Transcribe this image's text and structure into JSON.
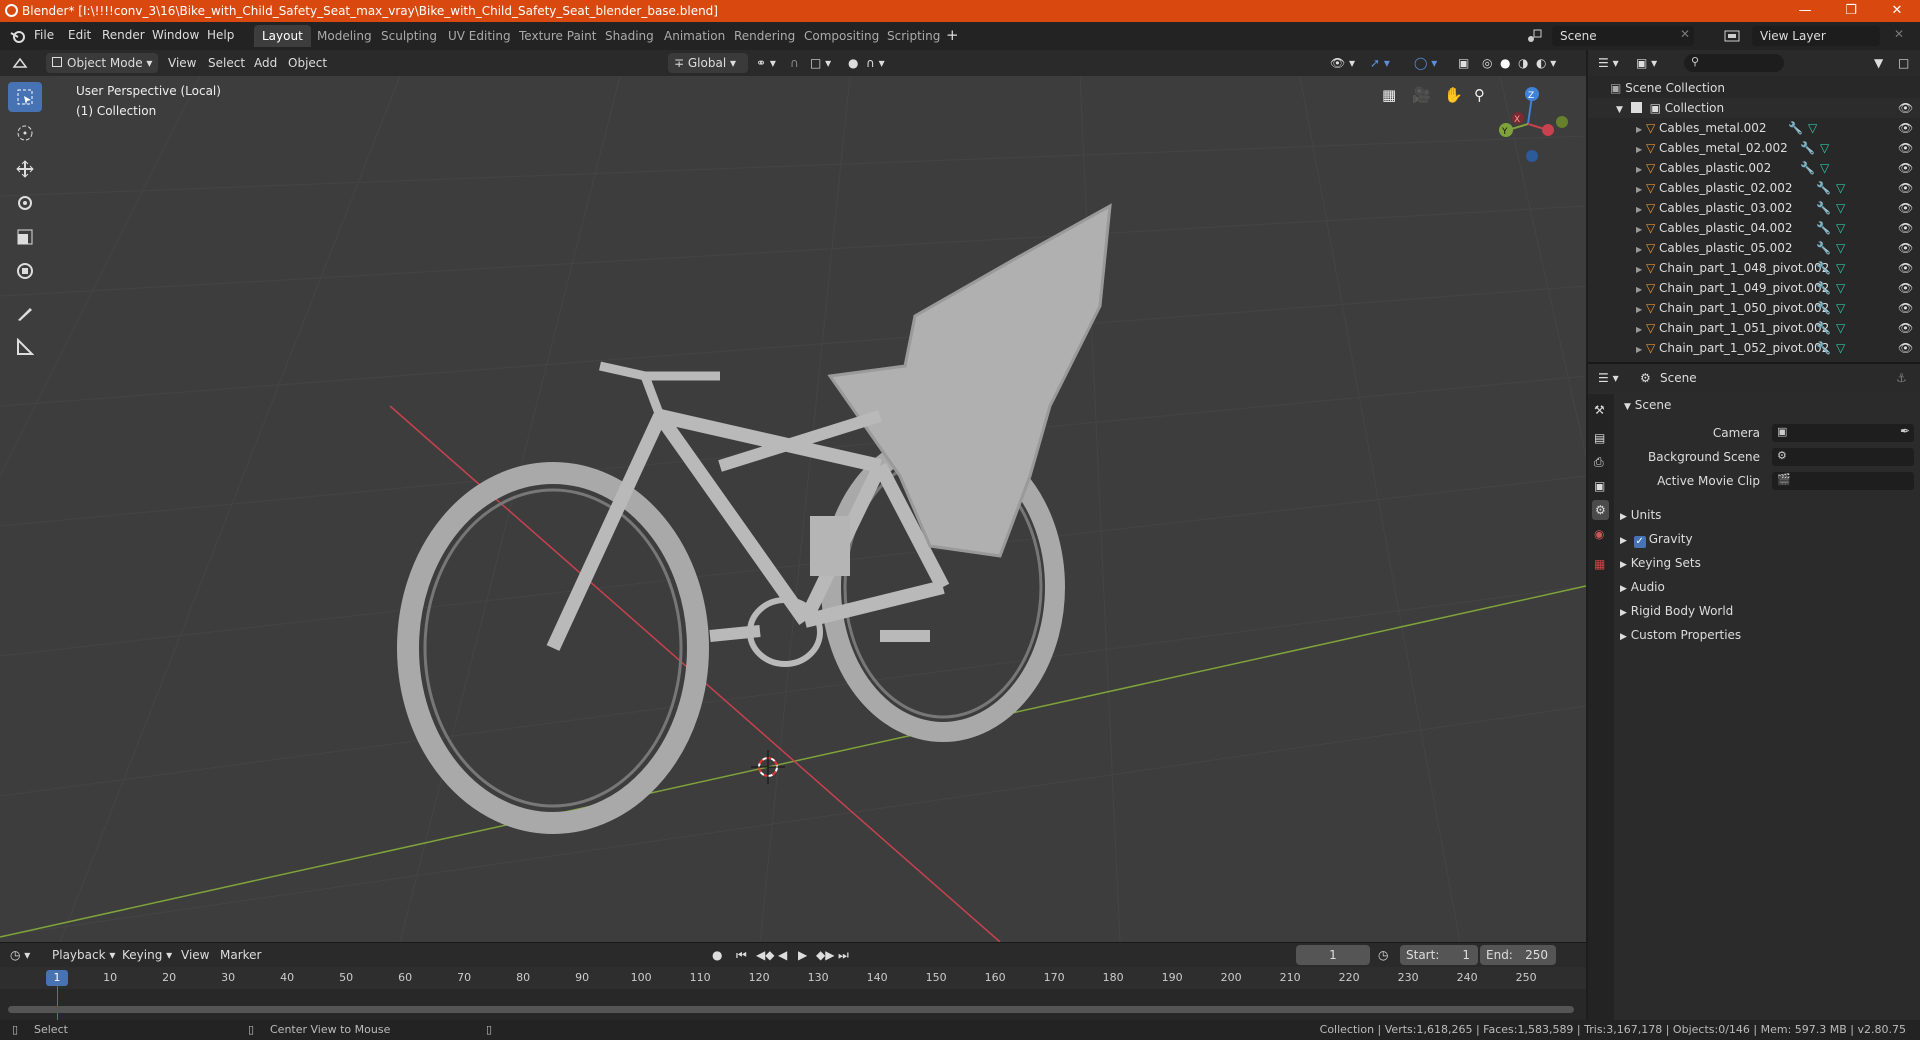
{
  "title": "Blender* [I:\\!!!!conv_3\\16\\Bike_with_Child_Safety_Seat_max_vray\\Bike_with_Child_Safety_Seat_blender_base.blend]",
  "menus": [
    "File",
    "Edit",
    "Render",
    "Window",
    "Help"
  ],
  "workspaces": [
    "Layout",
    "Modeling",
    "Sculpting",
    "UV Editing",
    "Texture Paint",
    "Shading",
    "Animation",
    "Rendering",
    "Compositing",
    "Scripting"
  ],
  "active_workspace": "Layout",
  "scene_field": "Scene",
  "view_layer_field": "View Layer",
  "viewport_header": {
    "mode": "Object Mode",
    "menus": [
      "View",
      "Select",
      "Add",
      "Object"
    ],
    "transform_orientation": "Global"
  },
  "viewport": {
    "perspective_label": "User Perspective (Local)",
    "collection_label": "(1) Collection",
    "gizmo_axes": [
      "X",
      "Y",
      "Z"
    ]
  },
  "outliner": {
    "root": "Scene Collection",
    "collection": "Collection",
    "items": [
      "Cables_metal.002",
      "Cables_metal_02.002",
      "Cables_plastic.002",
      "Cables_plastic_02.002",
      "Cables_plastic_03.002",
      "Cables_plastic_04.002",
      "Cables_plastic_05.002",
      "Chain_part_1_048_pivot.002",
      "Chain_part_1_049_pivot.002",
      "Chain_part_1_050_pivot.002",
      "Chain_part_1_051_pivot.002",
      "Chain_part_1_052_pivot.002"
    ]
  },
  "properties": {
    "header": "Scene",
    "panel_title": "Scene",
    "fields": [
      "Camera",
      "Background Scene",
      "Active Movie Clip"
    ],
    "sections": [
      "Units",
      "Gravity",
      "Keying Sets",
      "Audio",
      "Rigid Body World",
      "Custom Properties"
    ],
    "gravity_checked": true
  },
  "timeline": {
    "menus": [
      "Playback",
      "Keying",
      "View",
      "Marker"
    ],
    "current_frame": "1",
    "start_label": "Start:",
    "start": "1",
    "end_label": "End:",
    "end": "250",
    "ruler": [
      "1",
      "10",
      "20",
      "30",
      "40",
      "50",
      "60",
      "70",
      "80",
      "90",
      "100",
      "110",
      "120",
      "130",
      "140",
      "150",
      "160",
      "170",
      "180",
      "190",
      "200",
      "210",
      "220",
      "230",
      "240",
      "250"
    ]
  },
  "status": {
    "left": "Select",
    "middle": "Center View to Mouse",
    "right": "Collection | Verts:1,618,265 | Faces:1,583,589 | Tris:3,167,178 | Objects:0/146 | Mem: 597.3 MB | v2.80.75"
  },
  "colors": {
    "titlebar": "#d9480f",
    "accent": "#4772b3",
    "x_axis": "#c8414e",
    "y_axis": "#7fa33a",
    "z_axis": "#3f82d8"
  }
}
